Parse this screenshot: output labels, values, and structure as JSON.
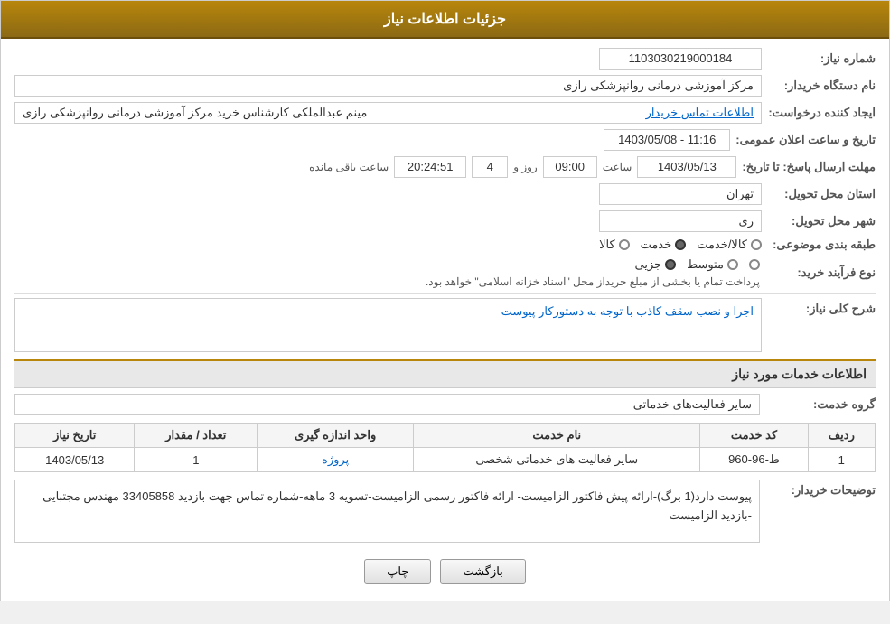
{
  "header": {
    "title": "جزئیات اطلاعات نیاز"
  },
  "fields": {
    "need_number_label": "شماره نیاز:",
    "need_number_value": "1103030219000184",
    "purchaser_label": "نام دستگاه خریدار:",
    "purchaser_value": "مرکز آموزشی درمانی روانپزشکی رازی",
    "creator_label": "ایجاد کننده درخواست:",
    "creator_value": "مینم عبدالملکی کارشناس خرید مرکز آموزشی درمانی روانپزشکی رازی",
    "contact_link": "اطلاعات تماس خریدار",
    "announce_date_label": "تاریخ و ساعت اعلان عمومی:",
    "announce_date_value": "1403/05/08 - 11:16",
    "reply_deadline_label": "مهلت ارسال پاسخ: تا تاریخ:",
    "reply_date": "1403/05/13",
    "reply_time_label": "ساعت",
    "reply_time": "09:00",
    "days_label": "روز و",
    "days_value": "4",
    "remaining_label": "ساعت باقی مانده",
    "remaining_time": "20:24:51",
    "province_label": "استان محل تحویل:",
    "province_value": "تهران",
    "city_label": "شهر محل تحویل:",
    "city_value": "ری",
    "category_label": "طبقه بندی موضوعی:",
    "category_options": [
      "کالا",
      "خدمت",
      "کالا/خدمت"
    ],
    "category_selected": "خدمت",
    "purchase_type_label": "نوع فرآیند خرید:",
    "purchase_types": [
      "جزیی",
      "متوسط",
      ""
    ],
    "purchase_procedure": "پرداخت تمام یا بخشی از مبلغ خریداز محل \"اسناد خزانه اسلامی\" خواهد بود.",
    "need_description_label": "شرح کلی نیاز:",
    "need_description_value": "اجرا و نصب سقف کاذب با توجه به دستورکار پیوست",
    "service_info_title": "اطلاعات خدمات مورد نیاز",
    "service_group_label": "گروه خدمت:",
    "service_group_value": "سایر فعالیت‌های خدماتی",
    "table_headers": [
      "ردیف",
      "کد خدمت",
      "نام خدمت",
      "واحد اندازه گیری",
      "تعداد / مقدار",
      "تاریخ نیاز"
    ],
    "table_rows": [
      {
        "row": "1",
        "code": "ط-96-960",
        "name": "سایر فعالیت های خدماتی شخصی",
        "unit": "پروژه",
        "quantity": "1",
        "date": "1403/05/13"
      }
    ],
    "buyer_notes_label": "توضیحات خریدار:",
    "buyer_notes_value": "پیوست دارد(1 برگ)-ارائه پیش فاکتور الزامیست- ارائه فاکتور رسمی الزامیست-تسویه 3 ماهه-شماره تماس جهت بازدید 33405858 مهندس مجتبایی -بازدید الزامیست"
  },
  "buttons": {
    "print_label": "چاپ",
    "back_label": "بازگشت"
  }
}
